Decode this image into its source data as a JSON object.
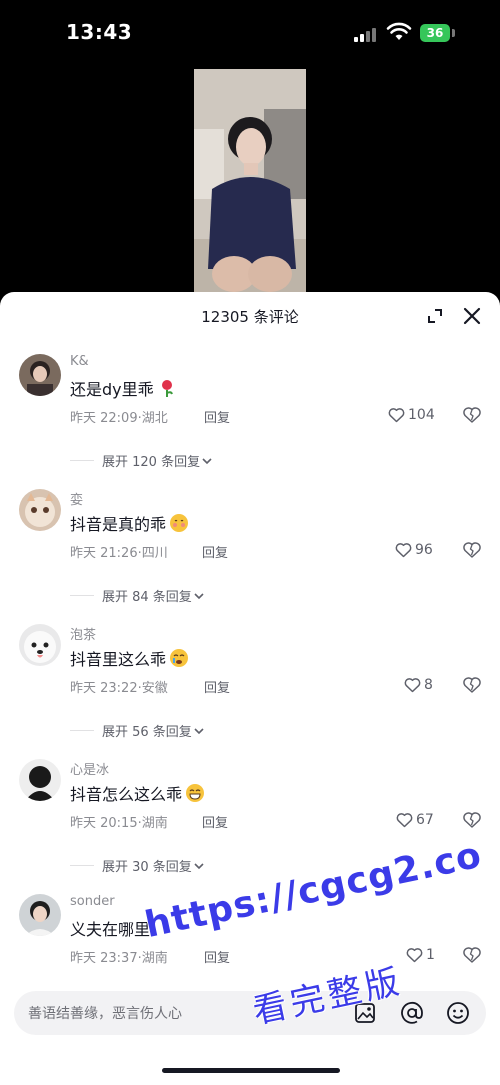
{
  "status_bar": {
    "time": "13:43",
    "battery": "36"
  },
  "sheet": {
    "title": "12305 条评论"
  },
  "comments": [
    {
      "name": "K&",
      "text": "还是dy里乖",
      "date": "昨天 22:09",
      "location": "湖北",
      "reply": "回复",
      "likes": "104",
      "expand": "展开 120 条回复"
    },
    {
      "name": "娈",
      "text": "抖音是真的乖",
      "date": "昨天 21:26",
      "location": "四川",
      "reply": "回复",
      "likes": "96",
      "expand": "展开 84 条回复"
    },
    {
      "name": "泡茶",
      "text": "抖音里这么乖",
      "date": "昨天 23:22",
      "location": "安徽",
      "reply": "回复",
      "likes": "8",
      "expand": "展开 56 条回复"
    },
    {
      "name": "心是冰",
      "text": "抖音怎么这么乖",
      "date": "昨天 20:15",
      "location": "湖南",
      "reply": "回复",
      "likes": "67",
      "expand": "展开 30 条回复"
    },
    {
      "name": "sonder",
      "text": "义夫在哪里",
      "date": "昨天 23:37",
      "location": "湖南",
      "reply": "回复",
      "likes": "1"
    }
  ],
  "input": {
    "placeholder": "善语结善缘，恶言伤人心"
  },
  "watermark": {
    "url": "https://cgcg2.co",
    "caption": "看完整版"
  },
  "colors": {
    "battery": "#36c65a",
    "watermark": "#3b3be8"
  }
}
